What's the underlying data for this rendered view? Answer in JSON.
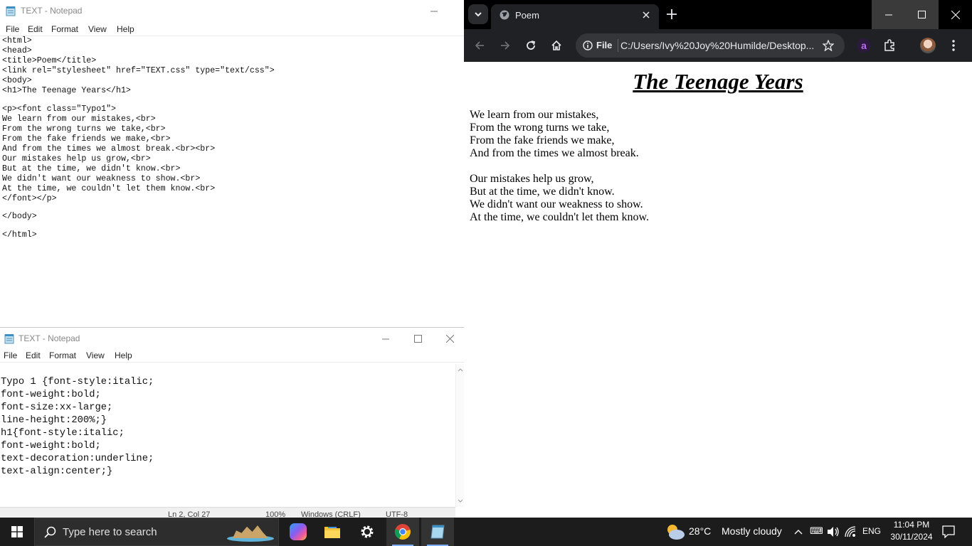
{
  "notepad_top": {
    "title": "TEXT - Notepad",
    "menu": [
      "File",
      "Edit",
      "Format",
      "View",
      "Help"
    ],
    "lines": [
      "<html>",
      "<head>",
      "<title>Poem</title>",
      "<link rel=\"stylesheet\" href=\"TEXT.css\" type=\"text/css\">",
      "<body>",
      "<h1>The Teenage Years</h1>",
      "",
      "<p><font class=\"Typo1\">",
      "We learn from our mistakes,<br>",
      "From the wrong turns we take,<br>",
      "From the fake friends we make,<br>",
      "And from the times we almost break.<br><br>",
      "Our mistakes help us grow,<br>",
      "But at the time, we didn't know.<br>",
      "We didn't want our weakness to show.<br>",
      "At the time, we couldn't let them know.<br>",
      "</font></p>",
      "",
      "</body>",
      "",
      "</html>"
    ]
  },
  "notepad_bottom": {
    "title": "TEXT - Notepad",
    "menu": [
      "File",
      "Edit",
      "Format",
      "View",
      "Help"
    ],
    "lines": [
      "Typo 1 {font-style:italic;",
      "font-weight:bold;",
      "font-size:xx-large;",
      "line-height:200%;}",
      "h1{font-style:italic;",
      "font-weight:bold;",
      "text-decoration:underline;",
      "text-align:center;}"
    ],
    "status": {
      "position": "Ln 2, Col 27",
      "zoom": "100%",
      "line_ending": "Windows (CRLF)",
      "encoding": "UTF-8"
    }
  },
  "browser": {
    "tab_title": "Poem",
    "address_scheme": "File",
    "address": "C:/Users/Ivy%20Joy%20Humilde/Desktop...",
    "page": {
      "heading": "The Teenage Years",
      "stanza1": [
        "We learn from our mistakes,",
        "From the wrong turns we take,",
        "From the fake friends we make,",
        "And from the times we almost break."
      ],
      "stanza2": [
        "Our mistakes help us grow,",
        "But at the time, we didn't know.",
        "We didn't want our weakness to show.",
        "At the time, we couldn't let them know."
      ]
    }
  },
  "taskbar": {
    "search_placeholder": "Type here to search",
    "weather_temp": "28°C",
    "weather_desc": "Mostly cloudy",
    "language": "ENG",
    "time": "11:04 PM",
    "date": "30/11/2024"
  },
  "colors": {
    "taskbar_bg": "#1c1c1c",
    "chrome_tabbar_bg": "#000000",
    "chrome_toolbar_bg": "#202124",
    "extension_accent": "#8a3ccf"
  }
}
